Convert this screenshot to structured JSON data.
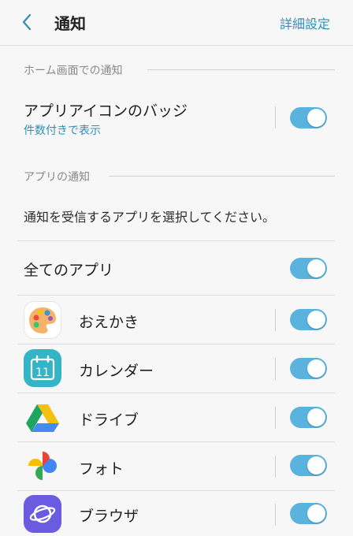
{
  "header": {
    "title": "通知",
    "action_label": "詳細設定",
    "back_icon": "chevron-left-icon"
  },
  "home_section": {
    "header": "ホーム画面での通知",
    "badge_row": {
      "title": "アプリアイコンのバッジ",
      "subtitle": "件数付きで表示",
      "toggle_on": true
    }
  },
  "app_section": {
    "header": "アプリの通知",
    "description": "通知を受信するアプリを選択してください。",
    "all_apps": {
      "label": "全てのアプリ",
      "toggle_on": true
    },
    "apps": [
      {
        "name": "おえかき",
        "icon": "palette-icon",
        "toggle_on": true
      },
      {
        "name": "カレンダー",
        "icon": "calendar-icon",
        "toggle_on": true
      },
      {
        "name": "ドライブ",
        "icon": "drive-icon",
        "toggle_on": true
      },
      {
        "name": "フォト",
        "icon": "photos-icon",
        "toggle_on": true
      },
      {
        "name": "ブラウザ",
        "icon": "browser-icon",
        "toggle_on": true
      }
    ]
  },
  "colors": {
    "accent": "#2e8fb8",
    "toggle_on": "#5ab3de",
    "background": "#f7f7f7"
  }
}
